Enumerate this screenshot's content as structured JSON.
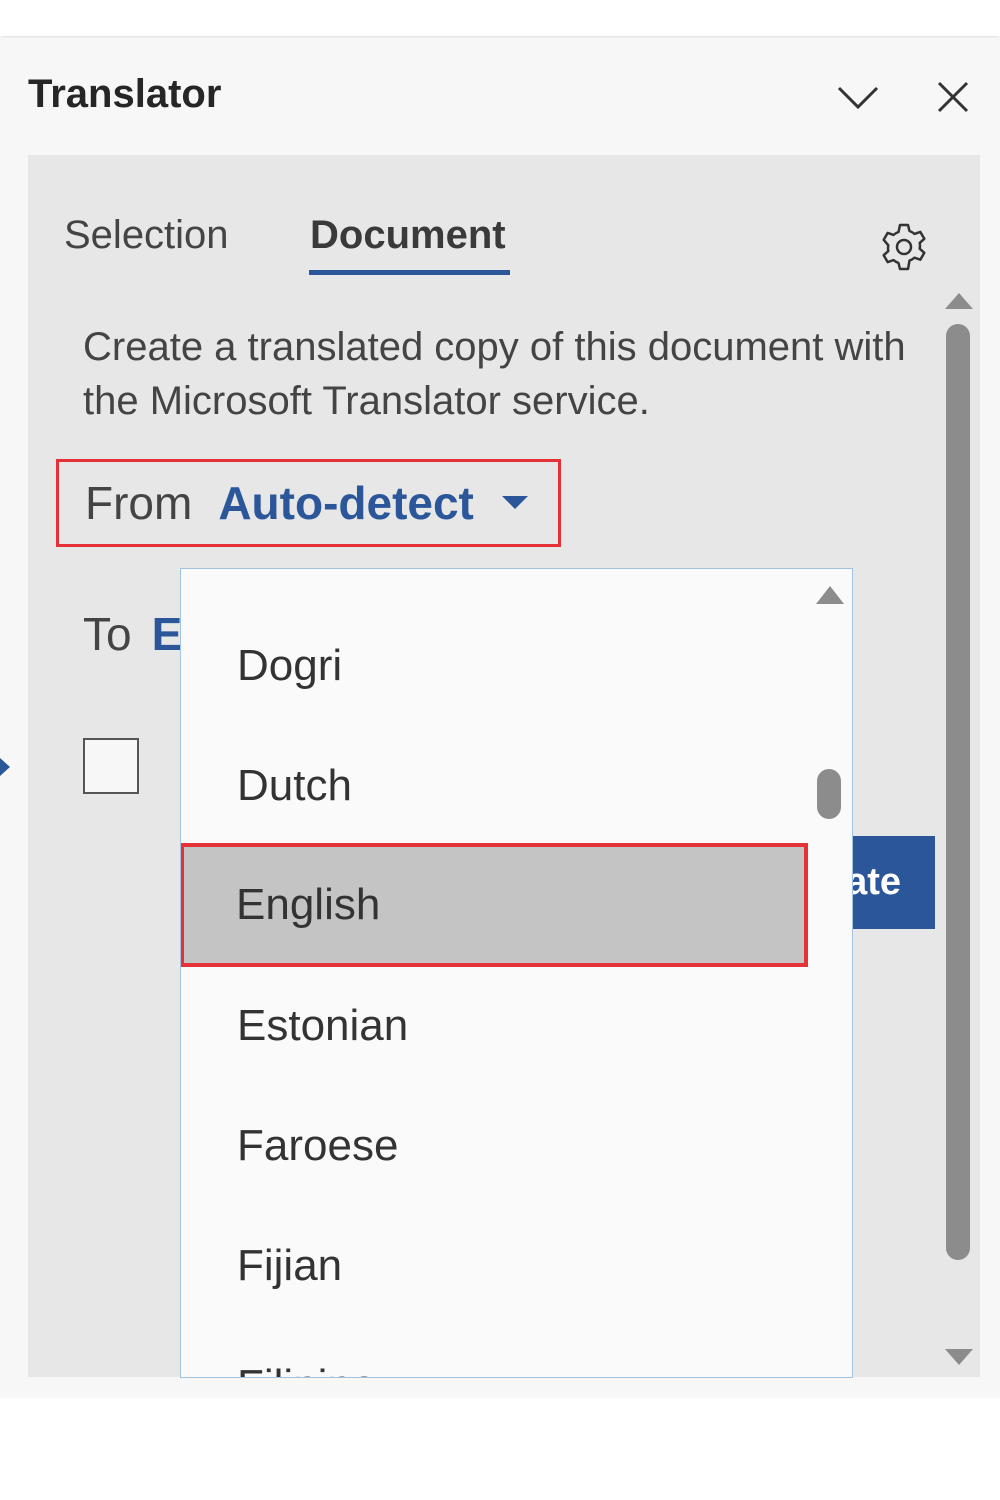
{
  "pane": {
    "title": "Translator",
    "collapse_icon": "chevron-down-icon",
    "close_icon": "close-icon"
  },
  "tabs": [
    {
      "label": "Selection",
      "active": false
    },
    {
      "label": "Document",
      "active": true
    }
  ],
  "settings_icon": "gear-icon",
  "description": "Create a translated copy of this document with the Microsoft Translator service.",
  "from": {
    "label": "From",
    "value": "Auto-detect",
    "caret_icon": "caret-down-icon"
  },
  "to": {
    "label": "To",
    "value_partial": "E"
  },
  "translate_button": {
    "label_partial": "ate"
  },
  "dropdown": {
    "options": [
      {
        "label": "Dogri"
      },
      {
        "label": "Dutch"
      },
      {
        "label": "English",
        "selected": true
      },
      {
        "label": "Estonian"
      },
      {
        "label": "Faroese"
      },
      {
        "label": "Fijian"
      },
      {
        "label": "Filipino"
      }
    ]
  },
  "colors": {
    "accent": "#2b579a",
    "highlight_border": "#e53138",
    "selected_bg": "#c4c4c4",
    "panel_bg": "#e7e7e7"
  }
}
